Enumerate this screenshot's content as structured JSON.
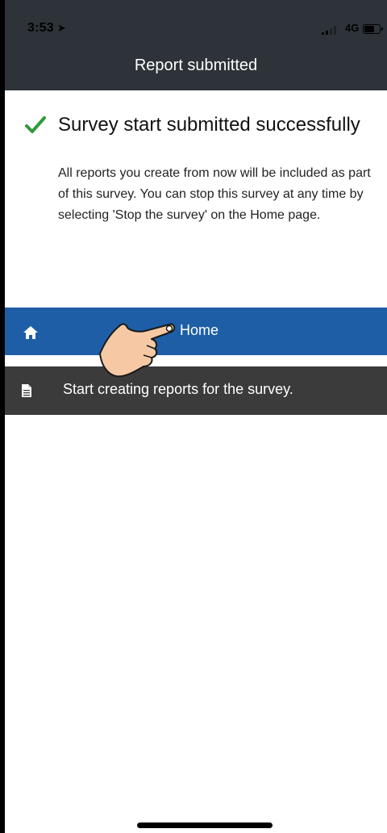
{
  "status_bar": {
    "time": "3:53",
    "network": "4G",
    "icons": [
      "location-arrow-icon",
      "signal-bars-icon",
      "battery-icon"
    ]
  },
  "nav": {
    "title": "Report submitted"
  },
  "success": {
    "icon": "checkmark-icon",
    "title": "Survey start submitted successfully",
    "body": "All reports you create from now will be included as part of this survey. You can stop this survey at any time by selecting 'Stop the survey' on the Home page."
  },
  "menu": {
    "home": {
      "icon": "home-icon",
      "label": "Home"
    },
    "reports": {
      "icon": "document-icon",
      "label": "Start creating reports for the survey."
    }
  },
  "overlay": {
    "icon": "pointing-hand-icon"
  },
  "colors": {
    "header_bg": "#2d3338",
    "check_green": "#2f9a3a",
    "home_bar_bg": "#1d5ea6",
    "reports_row_bg": "#3b3b3b"
  }
}
